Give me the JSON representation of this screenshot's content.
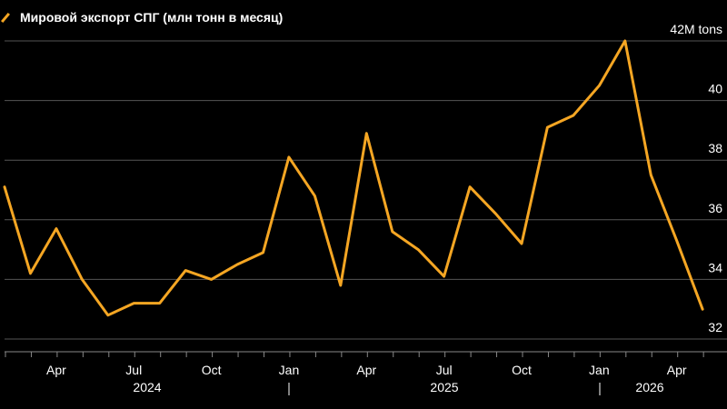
{
  "chart_data": {
    "type": "line",
    "title": "Мировой экспорт СПГ (млн тонн в месяц)",
    "y_unit_label": "42M tons",
    "y_ticks": [
      32,
      34,
      36,
      38,
      40,
      42
    ],
    "ylim": [
      31.5,
      42.5
    ],
    "x_month_labels": [
      "Apr",
      "Jul",
      "Oct",
      "Jan",
      "Apr",
      "Jul",
      "Oct",
      "Jan",
      "Apr"
    ],
    "x_year_labels": [
      "2024",
      "2025",
      "2026"
    ],
    "grid": true,
    "color": "#f5a623",
    "series": [
      {
        "x": [
          "2024-02",
          "2024-03",
          "2024-04",
          "2024-05",
          "2024-06",
          "2024-07",
          "2024-08",
          "2024-09",
          "2024-10",
          "2024-11",
          "2024-12",
          "2025-01",
          "2025-02",
          "2025-03",
          "2025-04",
          "2025-05",
          "2025-06",
          "2025-07",
          "2025-08",
          "2025-09",
          "2025-10",
          "2025-11",
          "2025-12",
          "2026-01",
          "2026-02",
          "2026-03",
          "2026-04",
          "2026-05"
        ],
        "values": [
          37.1,
          34.2,
          35.7,
          34.0,
          32.8,
          33.2,
          33.2,
          34.3,
          34.0,
          34.5,
          34.9,
          38.1,
          36.8,
          33.8,
          38.9,
          35.6,
          35.0,
          34.1,
          37.1,
          36.2,
          35.2,
          39.1,
          39.5,
          40.5,
          42.0,
          37.5,
          35.3,
          33.0
        ]
      }
    ]
  }
}
